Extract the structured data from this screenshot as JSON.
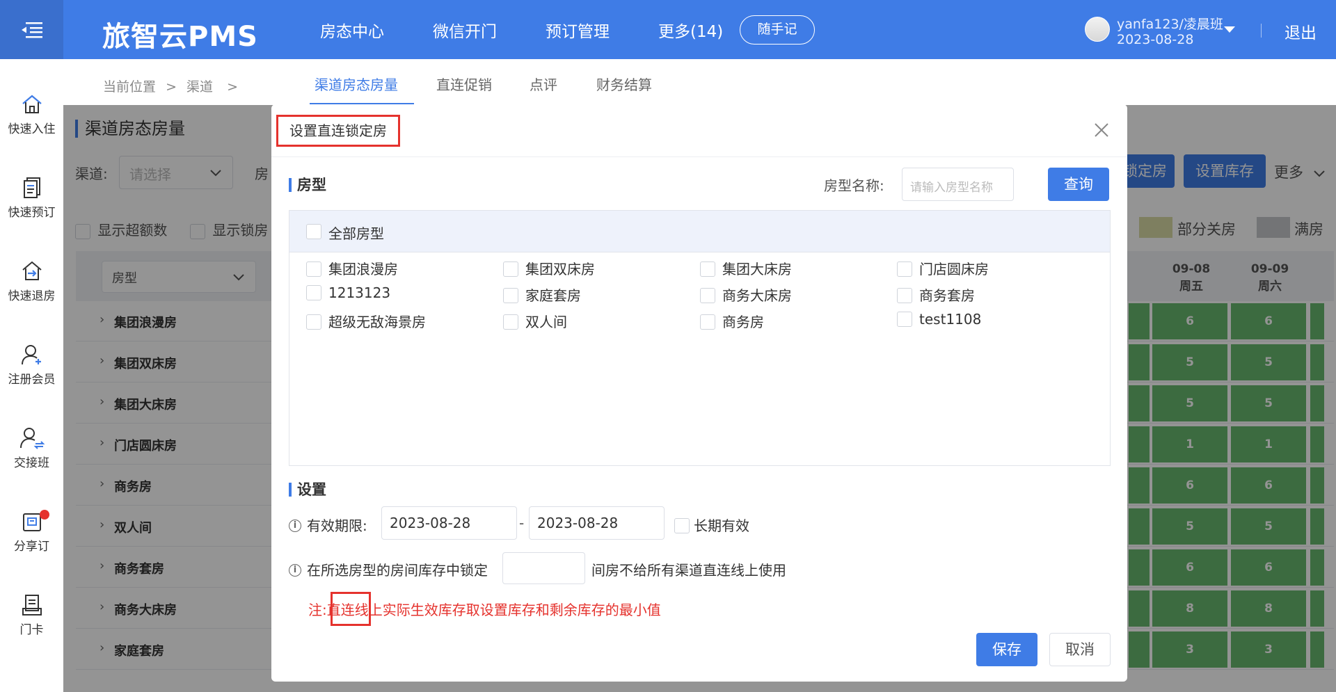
{
  "app": {
    "title": "旅智云PMS"
  },
  "nav": {
    "items": [
      "房态中心",
      "微信开门",
      "预订管理",
      "更多(14)"
    ],
    "memo_button": "随手记"
  },
  "user": {
    "name": "yanfa123/凌晨班",
    "date": "2023-08-28",
    "logout": "退出"
  },
  "sidebar": {
    "items": [
      {
        "label": "快速入住",
        "icon": "home-icon"
      },
      {
        "label": "快速预订",
        "icon": "document-icon"
      },
      {
        "label": "快速退房",
        "icon": "checkout-icon"
      },
      {
        "label": "注册会员",
        "icon": "add-user-icon"
      },
      {
        "label": "交接班",
        "icon": "shift-handover-icon"
      },
      {
        "label": "分享订",
        "icon": "share-order-icon"
      },
      {
        "label": "门卡",
        "icon": "door-card-icon"
      }
    ]
  },
  "breadcrumb": {
    "prefix": "当前位置",
    "sep": ">",
    "current": "渠道"
  },
  "tabs": [
    "渠道房态房量",
    "直连促销",
    "点评",
    "财务结算"
  ],
  "background": {
    "page_title": "渠道房态房量",
    "channel_label": "渠道:",
    "channel_placeholder": "请选择",
    "room_label_partial": "房",
    "show_overflow": "显示超额数",
    "show_locked": "显示锁房",
    "btn_lock_partial": "锁定房",
    "btn_set_stock": "设置库存",
    "more": "更多",
    "legend": [
      {
        "label": "部分关房",
        "color": "#d9dba6"
      },
      {
        "label": "满房",
        "color": "#c7c9cc"
      }
    ],
    "table": {
      "type_select": "房型",
      "dates": [
        {
          "date": "09-08",
          "weekday": "周五"
        },
        {
          "date": "09-09",
          "weekday": "周六"
        }
      ],
      "rows": [
        {
          "name": "集团浪漫房",
          "values": [
            "6",
            "6"
          ]
        },
        {
          "name": "集团双床房",
          "values": [
            "5",
            "5"
          ]
        },
        {
          "name": "集团大床房",
          "values": [
            "5",
            "5"
          ]
        },
        {
          "name": "门店圆床房",
          "values": [
            "1",
            "1"
          ]
        },
        {
          "name": "商务房",
          "values": [
            "6",
            "6"
          ]
        },
        {
          "name": "双人间",
          "values": [
            "5",
            "5"
          ]
        },
        {
          "name": "商务套房",
          "values": [
            "6",
            "6"
          ]
        },
        {
          "name": "商务大床房",
          "values": [
            "8",
            "8"
          ]
        },
        {
          "name": "家庭套房",
          "values": [
            "3",
            "3"
          ]
        }
      ]
    }
  },
  "modal": {
    "title": "设置直连锁定房",
    "room_section": "房型",
    "room_name_label": "房型名称:",
    "room_name_placeholder": "请输入房型名称",
    "query_button": "查询",
    "all_types": "全部房型",
    "room_types": [
      "集团浪漫房",
      "集团双床房",
      "集团大床房",
      "门店圆床房",
      "1213123",
      "家庭套房",
      "商务大床房",
      "商务套房",
      "超级无敌海景房",
      "双人间",
      "商务房",
      "test1108"
    ],
    "settings_section": "设置",
    "validity_label": "有效期限:",
    "date_start": "2023-08-28",
    "date_sep": "-",
    "date_end": "2023-08-28",
    "long_term": "长期有效",
    "lock_prefix": "在所选房型的房间库存中锁定",
    "lock_value": "",
    "lock_suffix": "间房不给所有渠道直连线上使用",
    "note": "注:直连线上实际生效库存取设置库存和剩余库存的最小值",
    "save_button": "保存",
    "cancel_button": "取消"
  }
}
